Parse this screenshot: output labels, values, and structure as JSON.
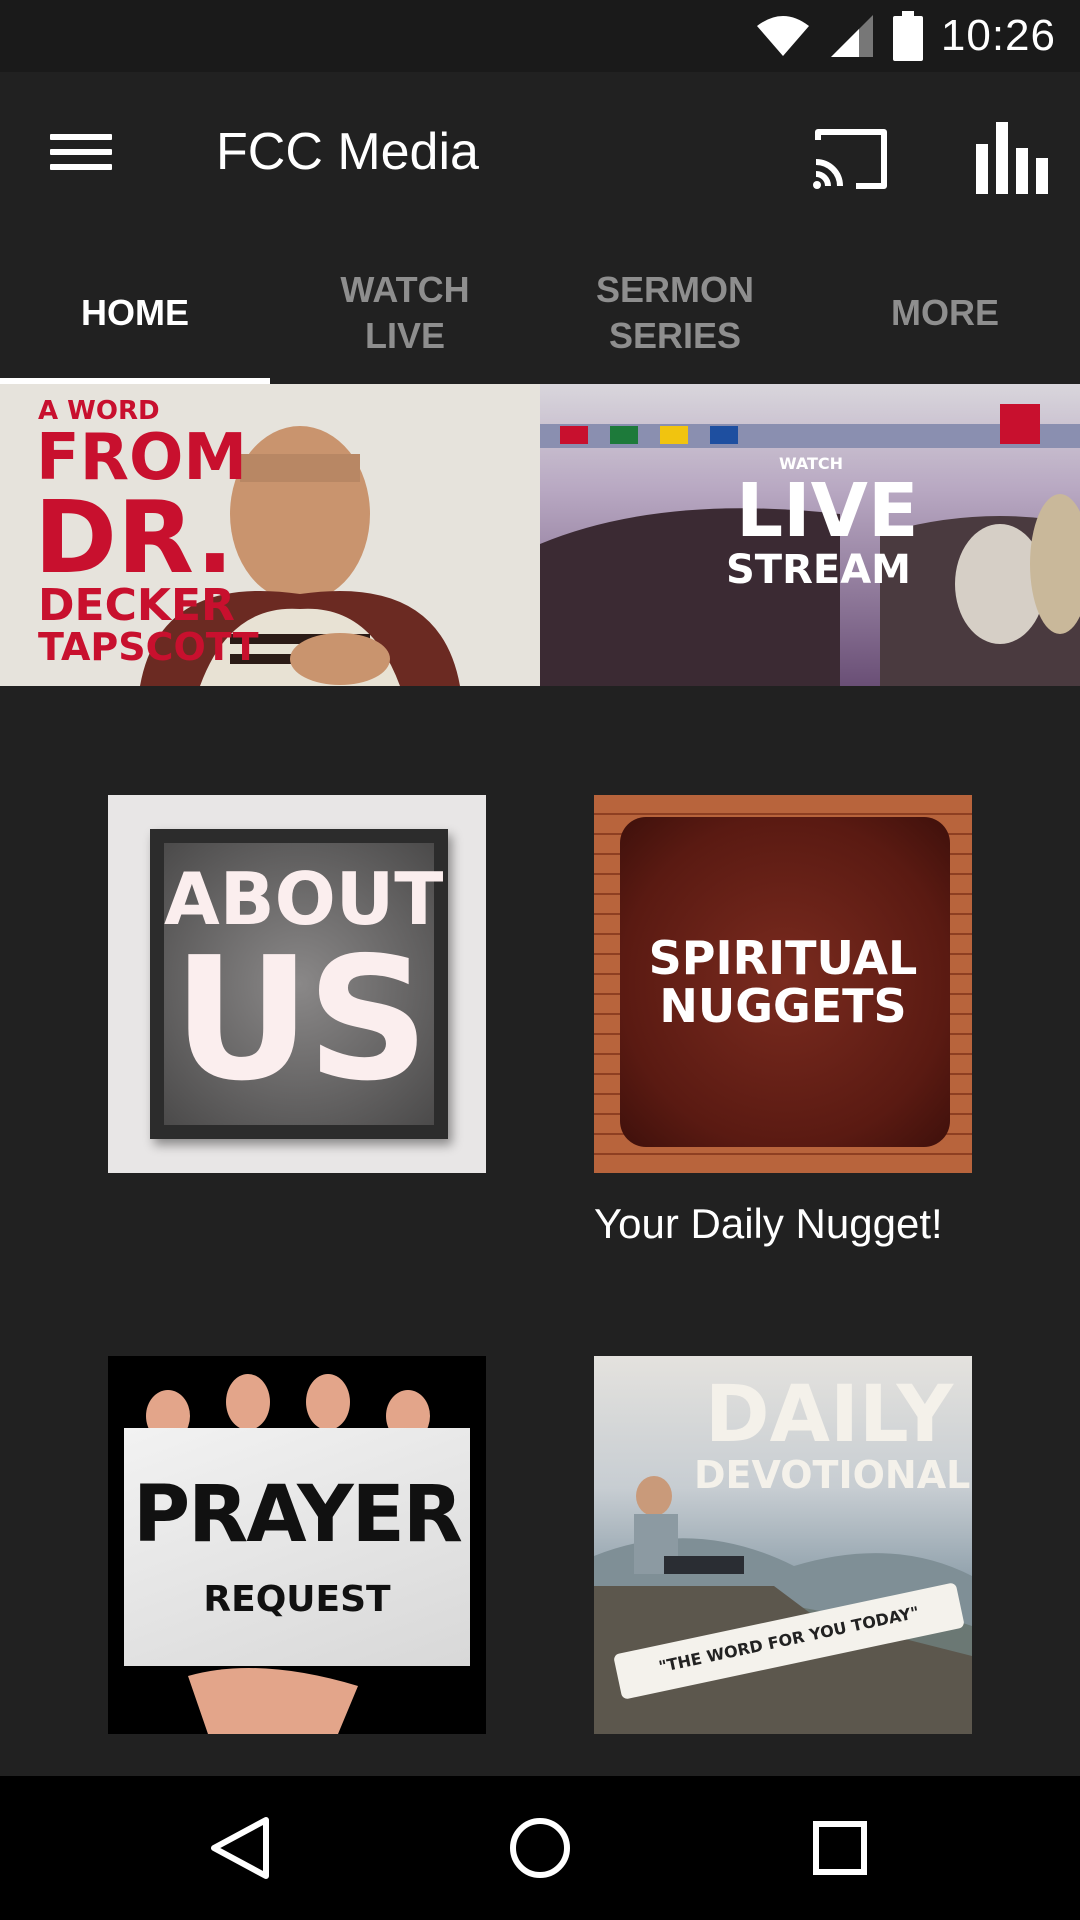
{
  "status_bar": {
    "time": "10:26",
    "icons": [
      "wifi-icon",
      "cell-signal-icon",
      "battery-icon"
    ]
  },
  "app_bar": {
    "title": "FCC Media",
    "icons": [
      "menu-icon",
      "cast-icon",
      "bar-chart-icon"
    ]
  },
  "tabs": [
    {
      "label": "HOME",
      "active": true
    },
    {
      "label": "WATCH\nLIVE",
      "active": false
    },
    {
      "label": "SERMON\nSERIES",
      "active": false
    },
    {
      "label": "MORE",
      "active": false
    }
  ],
  "hero": {
    "left": {
      "line1": "A WORD",
      "line2": "FROM",
      "line3": "DR.",
      "line4": "DECKER",
      "line5": "TAPSCOTT"
    },
    "right": {
      "line1": "WATCH",
      "line2": "LIVE",
      "line3": "STREAM"
    }
  },
  "tiles": {
    "about": {
      "line1": "ABOUT",
      "line2": "US"
    },
    "nuggets": {
      "line1": "SPIRITUAL",
      "line2": "NUGGETS",
      "caption": "Your Daily Nugget!"
    },
    "prayer": {
      "line1": "PRAYER",
      "line2": "REQUEST"
    },
    "devotional": {
      "line1": "DAILY",
      "line2": "DEVOTIONAL",
      "banner": "\"THE WORD FOR YOU TODAY\""
    }
  },
  "nav_bar": {
    "icons": [
      "back-icon",
      "home-icon",
      "recents-icon"
    ]
  },
  "colors": {
    "background": "#212121",
    "accent_red": "#c8102e",
    "tab_inactive": "#8e8e8e"
  }
}
